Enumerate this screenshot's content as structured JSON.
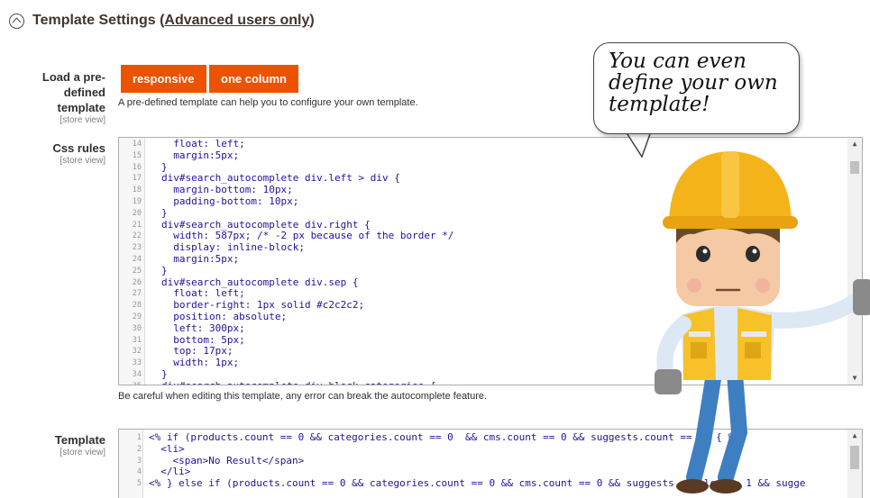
{
  "section": {
    "title": "Template Settings (",
    "link": "Advanced users only",
    "title_end": ")"
  },
  "predefined": {
    "label": "Load a pre-defined template",
    "scope": "[store view]",
    "buttons": [
      "responsive",
      "one column"
    ],
    "note": "A pre-defined template can help you to configure your own template."
  },
  "css_rules": {
    "label": "Css rules",
    "scope": "[store view]",
    "note": "Be careful when editing this template, any error can break the autocomplete feature.",
    "lines": [
      {
        "n": "14",
        "text": "  float: left;"
      },
      {
        "n": "15",
        "text": "  margin:5px;"
      },
      {
        "n": "16",
        "text": "}"
      },
      {
        "n": "17",
        "text": "div#search_autocomplete div.left > div {"
      },
      {
        "n": "18",
        "text": "  margin-bottom: 10px;"
      },
      {
        "n": "19",
        "text": "  padding-bottom: 10px;"
      },
      {
        "n": "20",
        "text": "}"
      },
      {
        "n": "21",
        "text": "div#search_autocomplete div.right {"
      },
      {
        "n": "22",
        "text": "  width: 587px; /* -2 px because of the border */"
      },
      {
        "n": "23",
        "text": "  display: inline-block;"
      },
      {
        "n": "24",
        "text": "  margin:5px;"
      },
      {
        "n": "25",
        "text": "}"
      },
      {
        "n": "26",
        "text": "div#search_autocomplete div.sep {"
      },
      {
        "n": "27",
        "text": "  float: left;"
      },
      {
        "n": "28",
        "text": "  border-right: 1px solid #c2c2c2;"
      },
      {
        "n": "29",
        "text": "  position: absolute;"
      },
      {
        "n": "30",
        "text": "  left: 300px;"
      },
      {
        "n": "31",
        "text": "  bottom: 5px;"
      },
      {
        "n": "32",
        "text": "  top: 17px;"
      },
      {
        "n": "33",
        "text": "  width: 1px;"
      },
      {
        "n": "34",
        "text": "}"
      },
      {
        "n": "35",
        "text": "div#search_autocomplete div.block-categories {"
      }
    ]
  },
  "template": {
    "label": "Template",
    "scope": "[store view]",
    "lines": [
      {
        "n": "1",
        "text": "<% if (products.count == 0 && categories.count == 0  && cms.count == 0 && suggests.count == 0) { %>"
      },
      {
        "n": "2",
        "text": "  <li>"
      },
      {
        "n": "3",
        "text": "    <span>No Result</span>"
      },
      {
        "n": "4",
        "text": "  </li>"
      },
      {
        "n": "5",
        "text": "<% } else if (products.count == 0 && categories.count == 0 && cms.count == 0 && suggests.enabled == 1 && sugge"
      }
    ]
  },
  "bubble": {
    "line1": "You can even",
    "line2": "define your own",
    "line3": "template!"
  },
  "colors": {
    "accent": "#eb5202",
    "helmet": "#f5b31a",
    "vest": "#f7c12a",
    "shirt": "#dce9f5",
    "pants": "#3e7fc1"
  },
  "icons": {
    "collapse": "collapse-up-icon",
    "scroll_up": "arrow-up-icon",
    "scroll_down": "arrow-down-icon"
  }
}
